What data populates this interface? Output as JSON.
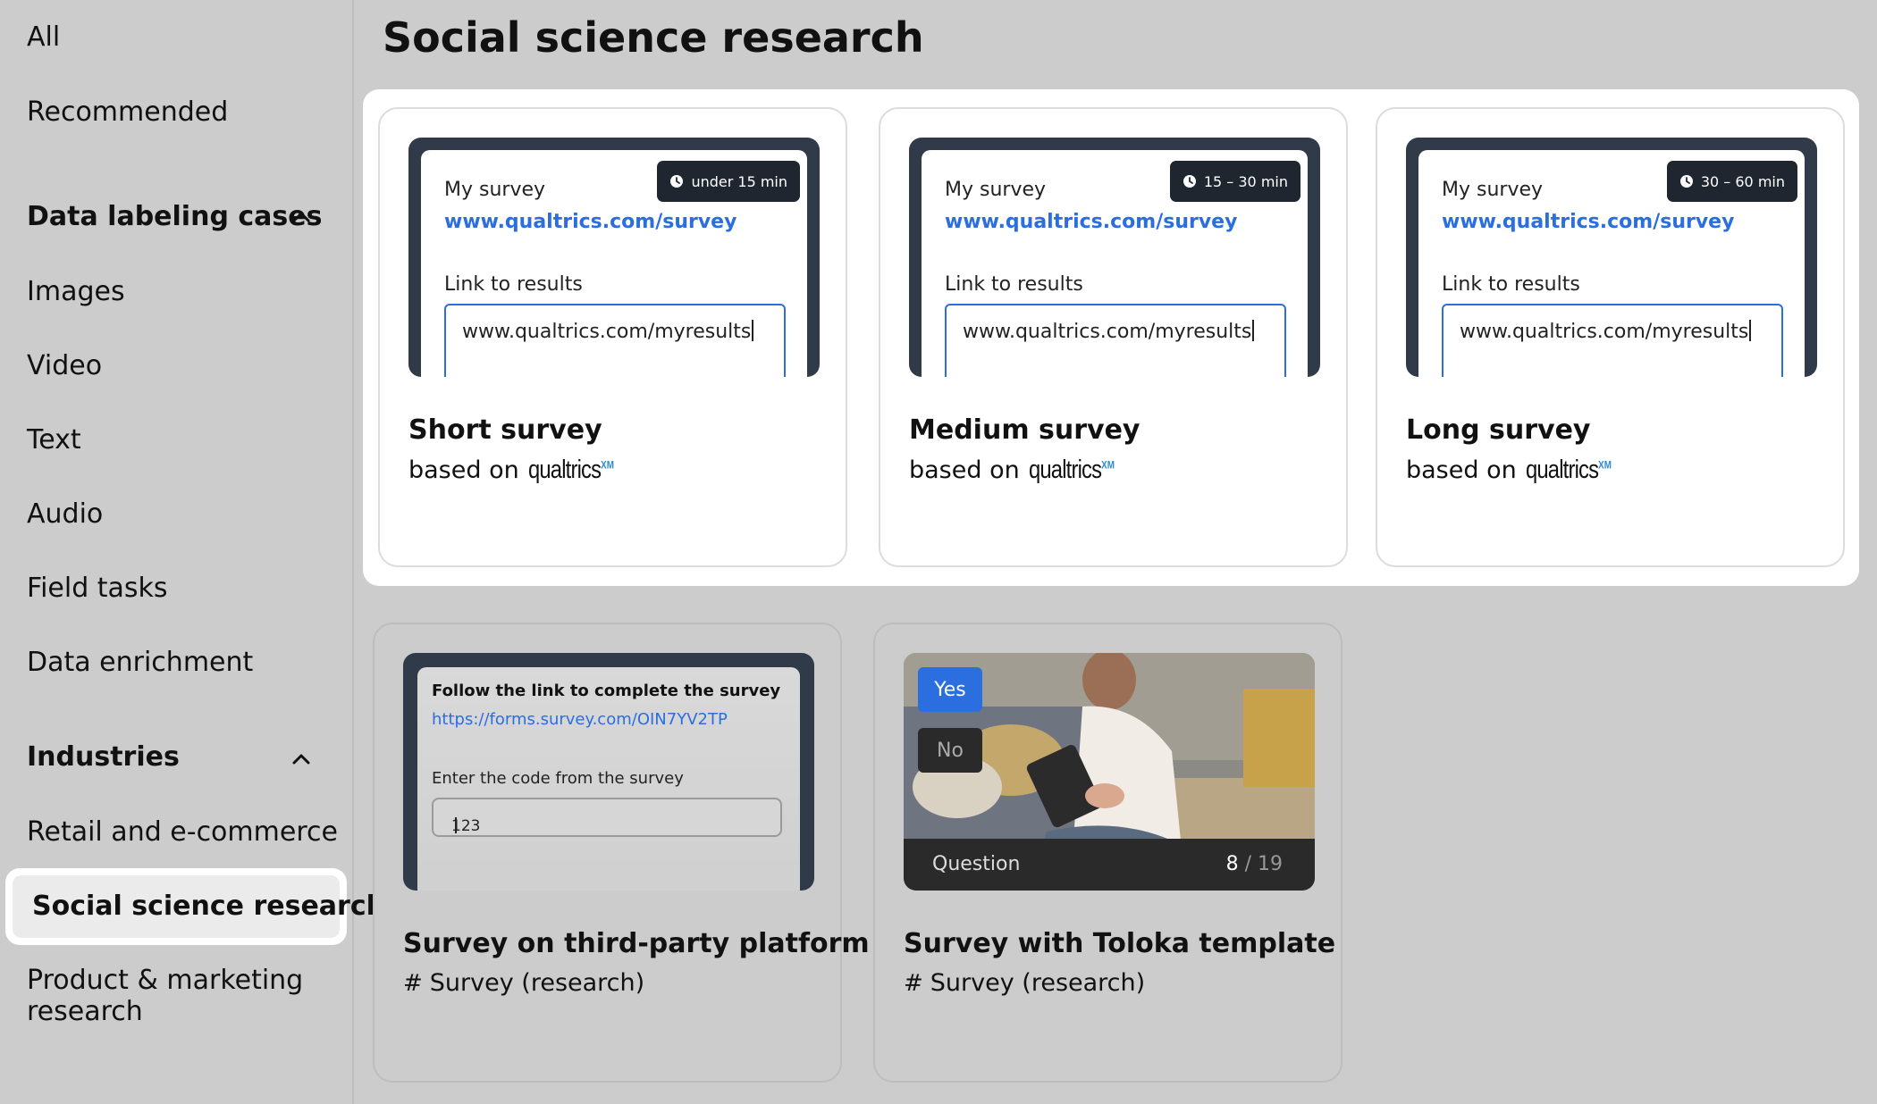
{
  "sidebar": {
    "all": "All",
    "recommended": "Recommended",
    "data_labeling_heading": "Data labeling cases",
    "data_labeling_items": [
      "Images",
      "Video",
      "Text",
      "Audio",
      "Field tasks",
      "Data enrichment"
    ],
    "industries_heading": "Industries",
    "industries_items": [
      "Retail and e-commerce",
      "Social science research",
      "Product & marketing",
      "research"
    ]
  },
  "page": {
    "title": "Social science research"
  },
  "survey_preview": {
    "my_survey": "My survey",
    "survey_link": "www.qualtrics.com/survey",
    "link_to_results": "Link to results",
    "results_value": "www.qualtrics.com/myresults"
  },
  "cards": [
    {
      "title": "Short survey",
      "based_on": "based on",
      "logo": "qualtrics",
      "logo_sup": "XM",
      "badge": "under 15 min"
    },
    {
      "title": "Medium survey",
      "based_on": "based on",
      "logo": "qualtrics",
      "logo_sup": "XM",
      "badge": "15 – 30 min"
    },
    {
      "title": "Long survey",
      "based_on": "based on",
      "logo": "qualtrics",
      "logo_sup": "XM",
      "badge": "30 – 60 min"
    }
  ],
  "card_third_party": {
    "title": "Survey on third-party platform",
    "tag": "Survey (research)",
    "preview_heading": "Follow the link to complete the survey",
    "preview_link": "https://forms.survey.com/OIN7YV2TP",
    "preview_code_label": "Enter the code from the survey",
    "preview_code_value": "123"
  },
  "card_toloka": {
    "title": "Survey with Toloka template",
    "tag": "Survey (research)",
    "yes": "Yes",
    "no": "No",
    "question_label": "Question",
    "question_current": "8",
    "question_total": "/ 19"
  },
  "colors": {
    "link_blue": "#2a6ee0",
    "yes_blue": "#2a6ee0",
    "preview_frame": "#303a48",
    "background": "#cccccc"
  }
}
